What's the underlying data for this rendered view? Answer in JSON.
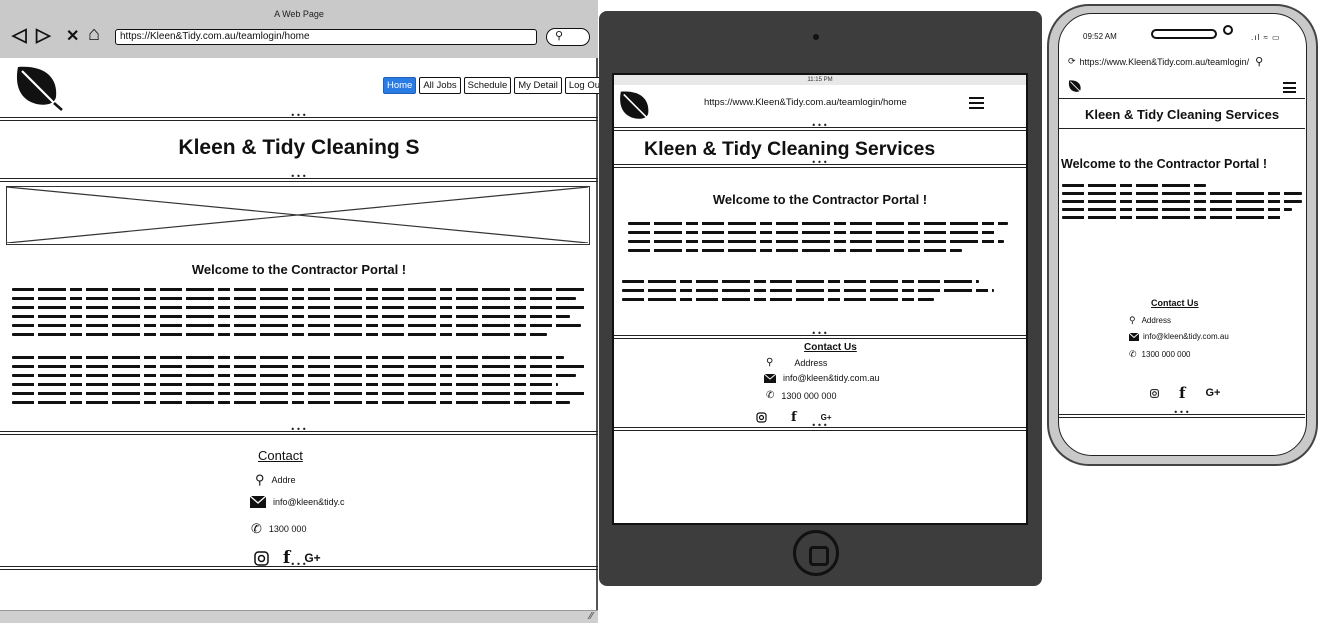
{
  "browser": {
    "window_title": "A Web Page",
    "url": "https://Kleen&Tidy.com.au/teamlogin/home",
    "nav_icons": {
      "back": "◁",
      "forward": "▷",
      "stop": "✕",
      "home": "⌂"
    },
    "menu": [
      "Home",
      "All Jobs",
      "Schedule",
      "My Detail",
      "Log Out"
    ],
    "heading": "Kleen & Tidy Cleaning S",
    "welcome": "Welcome to the Contractor Portal !",
    "contact": {
      "title": "Contact ",
      "address": "Addre",
      "email": "info@kleen&tidy.c",
      "phone": "1300 000"
    },
    "social": {
      "g_plus": "G+"
    }
  },
  "tablet": {
    "status_time": "11:15 PM",
    "url": "https://www.Kleen&Tidy.com.au/teamlogin/home",
    "heading": "Kleen & Tidy Cleaning Services",
    "welcome": "Welcome to the Contractor Portal !",
    "contact": {
      "title": "Contact Us",
      "address": "Address",
      "email": "info@kleen&tidy.com.au",
      "phone": "1300 000 000"
    },
    "social": {
      "g_plus": "G+"
    }
  },
  "phone": {
    "status_time": "09:52 AM",
    "url": "https://www.Kleen&Tidy.com.au/teamlogin/",
    "heading": "Kleen & Tidy Cleaning Services",
    "welcome": "Welcome to the Contractor Portal !",
    "contact": {
      "title": "Contact Us",
      "address": "Address",
      "email": "info@kleen&tidy.com.au",
      "phone": "1300 000 000"
    },
    "social": {
      "g_plus": "G+"
    }
  },
  "colors": {
    "active_menu": "#2a7be4",
    "chrome_gray": "#c9c9c9",
    "device_dark": "#3d3d3d"
  },
  "icons": [
    "leaf-logo-icon",
    "location-pin-icon",
    "envelope-icon",
    "phone-icon",
    "instagram-icon",
    "facebook-icon",
    "hamburger-menu-icon",
    "search-icon"
  ]
}
